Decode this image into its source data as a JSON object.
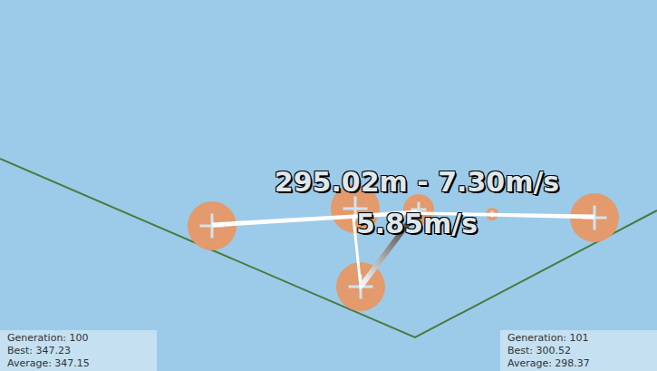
{
  "scene": {
    "car_label": "295.02m - 7.30m/s",
    "speed_label": "5.85m/s"
  },
  "stats_panels": [
    {
      "lines": [
        "Generation: 100",
        "Best: 347.23",
        "Average: 347.15"
      ]
    },
    {
      "lines": [
        "Generation: 101",
        "Best: 300.52",
        "Average: 298.37"
      ]
    }
  ]
}
